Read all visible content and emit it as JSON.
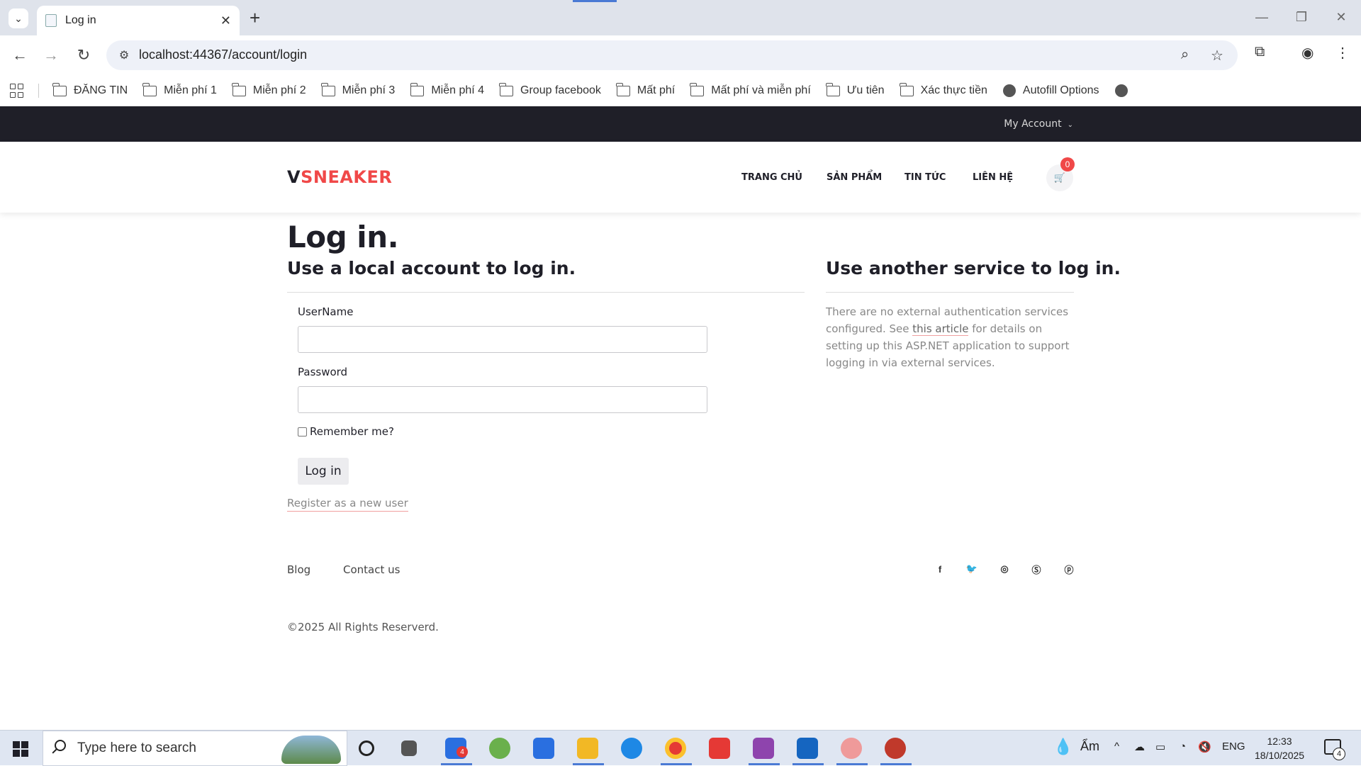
{
  "browser": {
    "tab_title": "Log in",
    "url": "localhost:44367/account/login",
    "bookmarks": [
      "ĐĂNG TIN",
      "Miễn phí 1",
      "Miễn phí 2",
      "Miễn phí 3",
      "Miễn phí 4",
      "Group facebook",
      "Mất phí",
      "Mất phí và miễn phí",
      "Ưu tiên",
      "Xác thực tiền",
      "Autofill Options"
    ]
  },
  "site": {
    "my_account": "My Account",
    "logo_v": "V",
    "logo_rest": "SNEAKER",
    "nav": [
      "TRANG CHỦ",
      "SẢN PHẨM",
      "TIN TỨC",
      "LIÊN HỆ"
    ],
    "cart_count": "0"
  },
  "login": {
    "title": "Log in.",
    "local_heading": "Use a local account to log in.",
    "username_label": "UserName",
    "password_label": "Password",
    "remember_label": "Remember me?",
    "submit_label": "Log in",
    "register_link": "Register as a new user"
  },
  "external": {
    "heading": "Use another service to log in.",
    "text_before": "There are no external authentication services configured. See ",
    "link_text": "this article",
    "text_after": " for details on setting up this ASP.NET application to support logging in via external services."
  },
  "footer": {
    "links": [
      "Blog",
      "Contact us"
    ],
    "social_icons": [
      "facebook-icon",
      "twitter-icon",
      "instagram-icon",
      "skype-icon",
      "pinterest-icon"
    ],
    "copyright": "©2025 All Rights Reserverd."
  },
  "taskbar": {
    "search_placeholder": "Type here to search",
    "weather": "Ẩm",
    "lang": "ENG",
    "time": "12:33",
    "date": "18/10/2025",
    "zalo_badge": "4",
    "notification_count": "4"
  },
  "colors": {
    "accent": "#f04848",
    "topbar": "#1f1f28"
  }
}
